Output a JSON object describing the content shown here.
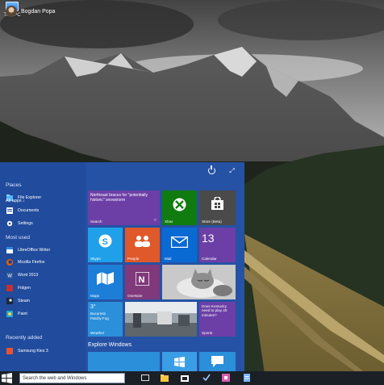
{
  "desktop": {
    "icon_label": "This PC"
  },
  "start_menu": {
    "user_name": "Bogdan Popa",
    "places_heading": "Places",
    "places": [
      "File Explorer",
      "Documents",
      "Settings"
    ],
    "most_used_heading": "Most used",
    "most_used": [
      "LibreOffice Writer",
      "Mozilla Firefox",
      "Word 2013",
      "Fidgen",
      "Steam",
      "Paint"
    ],
    "recently_added_heading": "Recently added",
    "recently_added": [
      "Samsung Kies 3"
    ],
    "all_apps": "All apps ↓",
    "explore_label": "Explore Windows",
    "tiles": {
      "search_news": "Northeast braces for \"potentially historic\" snowstorm",
      "search_label": "Search",
      "xbox": "Xbox",
      "store": "Store (Beta)",
      "skype": "Skype",
      "people": "People",
      "mail": "Mail",
      "calendar_day": "13",
      "calendar": "Calendar",
      "maps": "Maps",
      "onenote": "OneNote",
      "weather_temp": "3°",
      "weather_city": "Bucuresti",
      "weather_cond": "Patchy Fog",
      "weather": "Weather",
      "sports_news": "Does Kentucky need to play 40 minutes?",
      "sports": "Sports"
    }
  },
  "taskbar": {
    "search_placeholder": "Search the web and Windows"
  }
}
